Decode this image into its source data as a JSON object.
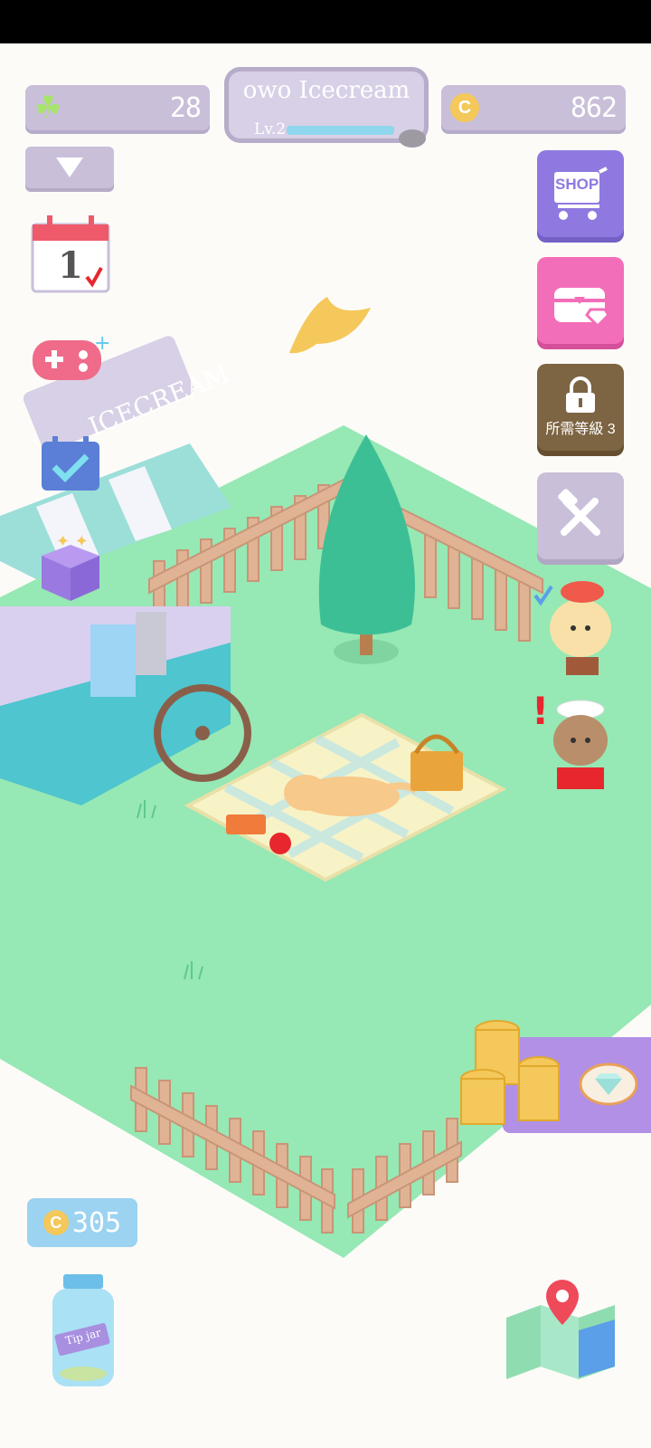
{
  "hud": {
    "clover_count": "28",
    "coin_count": "862",
    "shop_name": "owo Icecream",
    "level_label": "Lv.2",
    "level_progress": 0.85,
    "coin_symbol": "C"
  },
  "side_buttons": {
    "shop_label": "SHOP",
    "locked_label": "所需等級 3"
  },
  "calendar": {
    "day": "1"
  },
  "cart_sign": "ICECREAM",
  "tip_jar": {
    "coins": "305",
    "jar_label": "Tip jar"
  },
  "colors": {
    "grass": "#96e8b4",
    "shop_purple": "#8f79e0",
    "chest_pink": "#f36eb8",
    "coin": "#f4c85a"
  }
}
